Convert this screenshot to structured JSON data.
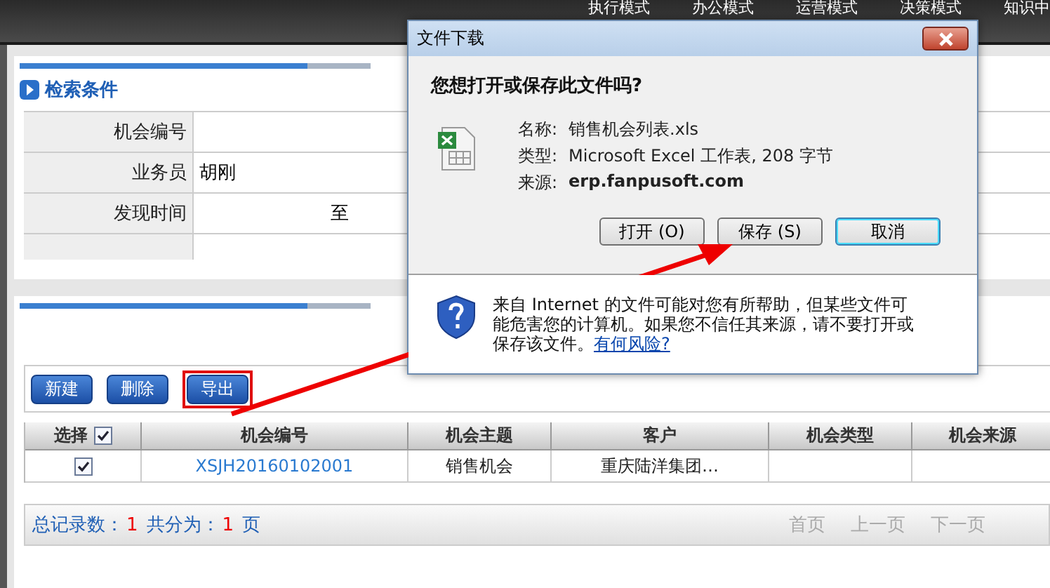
{
  "top_nav": [
    {
      "label": "执行模式"
    },
    {
      "label": "办公模式"
    },
    {
      "label": "运营模式"
    },
    {
      "label": "决策模式"
    },
    {
      "label": "知识中"
    }
  ],
  "search_panel": {
    "title": "检索条件",
    "fields": [
      {
        "label": "机会编号"
      },
      {
        "label": "业务员",
        "value": "胡刚"
      },
      {
        "label": "发现时间",
        "value": "至"
      }
    ]
  },
  "toolbar": [
    {
      "label": "新建",
      "highlighted": false
    },
    {
      "label": "删除",
      "highlighted": false
    },
    {
      "label": "导出",
      "highlighted": true
    }
  ],
  "table": {
    "select_all": {
      "label": "选择",
      "checked": true
    },
    "columns": [
      "机会编号",
      "机会主题",
      "客户",
      "机会类型",
      "机会来源"
    ],
    "rows": [
      {
        "selected": true,
        "cells": [
          "XSJH20160102001",
          "销售机会",
          "重庆陆洋集团…",
          "",
          ""
        ]
      }
    ]
  },
  "footer": {
    "total_label": "总记录数：",
    "total": "1",
    "pages_label": "共分为：",
    "pages": "1",
    "pages_unit": "页",
    "nav": [
      "首页",
      "上一页",
      "下一页"
    ]
  },
  "dialog": {
    "title": "文件下载",
    "question": "您想打开或保存此文件吗?",
    "info": [
      {
        "label": "名称:",
        "value": "销售机会列表.xls",
        "bold": false
      },
      {
        "label": "类型:",
        "value": "Microsoft Excel 工作表, 208 字节",
        "bold": false
      },
      {
        "label": "来源:",
        "value": "erp.fanpusoft.com",
        "bold": true
      }
    ],
    "buttons": [
      {
        "label": "打开 (O)",
        "default": false
      },
      {
        "label": "保存 (S)",
        "default": false
      },
      {
        "label": "取消",
        "default": true
      }
    ],
    "warning": "来自 Internet 的文件可能对您有所帮助，但某些文件可能危害您的计算机。如果您不信任其来源，请不要打开或保存该文件。",
    "risk_link": "有何风险?"
  }
}
